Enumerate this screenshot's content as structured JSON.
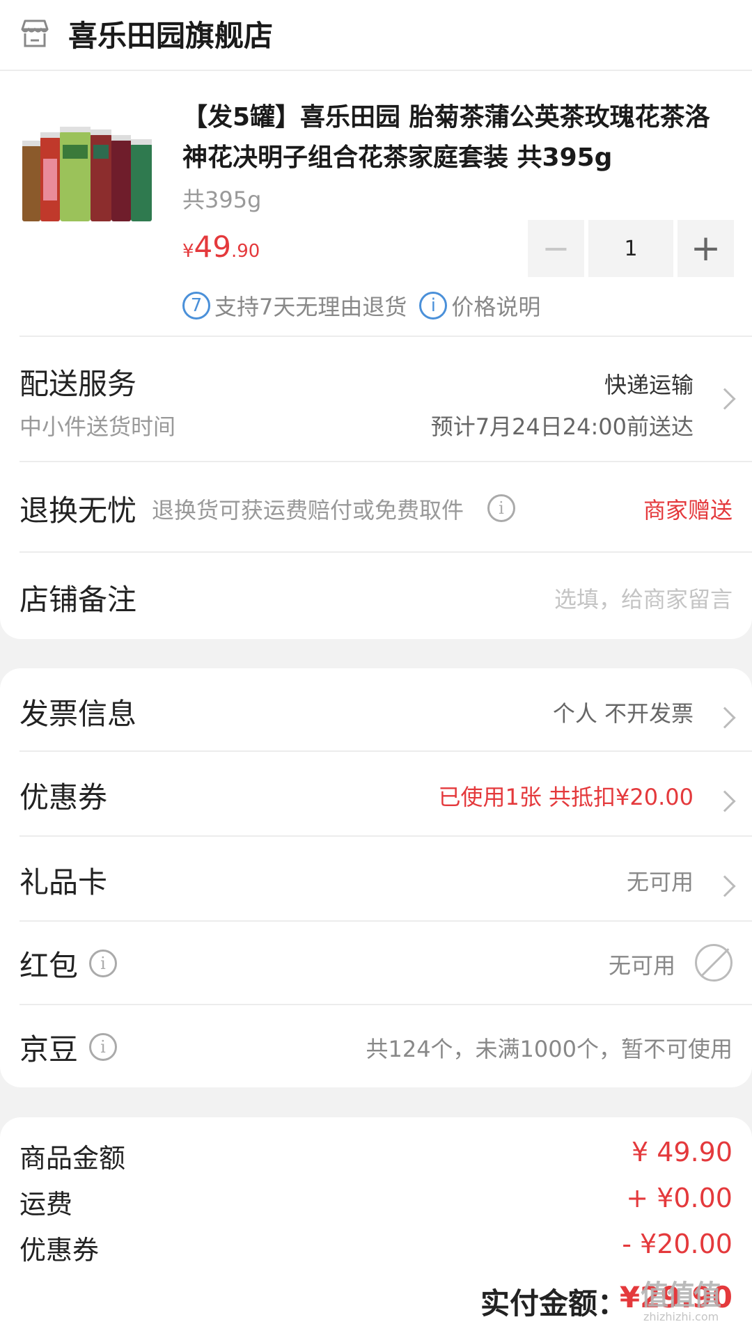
{
  "store": {
    "name": "喜乐田园旗舰店",
    "icon": "store-icon"
  },
  "product": {
    "title": "【发5罐】喜乐田园 胎菊茶蒲公英茶玫瑰花茶洛神花决明子组合花茶家庭套装 共395g",
    "spec": "共395g",
    "price_currency": "¥",
    "price_int": "49",
    "price_dec": ".90",
    "quantity": "1",
    "minus_symbol": "−",
    "plus_symbol": "+",
    "tag_return_icon": "7",
    "tag_return": "支持7天无理由退货",
    "tag_price_icon": "i",
    "tag_price": "价格说明"
  },
  "delivery": {
    "label": "配送服务",
    "sub": "中小件送货时间",
    "method": "快递运输",
    "eta": "预计7月24日24:00前送达"
  },
  "returns": {
    "label": "退换无忧",
    "desc": "退换货可获运费赔付或免费取件",
    "value": "商家赠送"
  },
  "note": {
    "label": "店铺备注",
    "placeholder": "选填，给商家留言"
  },
  "invoice": {
    "label": "发票信息",
    "value": "个人 不开发票"
  },
  "coupon": {
    "label": "优惠券",
    "value": "已使用1张 共抵扣¥20.00"
  },
  "giftcard": {
    "label": "礼品卡",
    "value": "无可用"
  },
  "redpacket": {
    "label": "红包",
    "value": "无可用"
  },
  "jingdou": {
    "label": "京豆",
    "value": "共124个，未满1000个，暂不可使用"
  },
  "summary": {
    "goods_label": "商品金额",
    "goods_value": "¥ 49.90",
    "shipping_label": "运费",
    "shipping_value": "+ ¥0.00",
    "coupon_label": "优惠券",
    "coupon_value": "- ¥20.00",
    "total_label": "实付金额：",
    "total_value": "¥29.90"
  },
  "watermark": {
    "text": "值值值",
    "small": "zhizhizhi.com"
  },
  "colors": {
    "accent": "#e4393c",
    "info": "#4a90d9",
    "background": "#f2f2f2"
  }
}
